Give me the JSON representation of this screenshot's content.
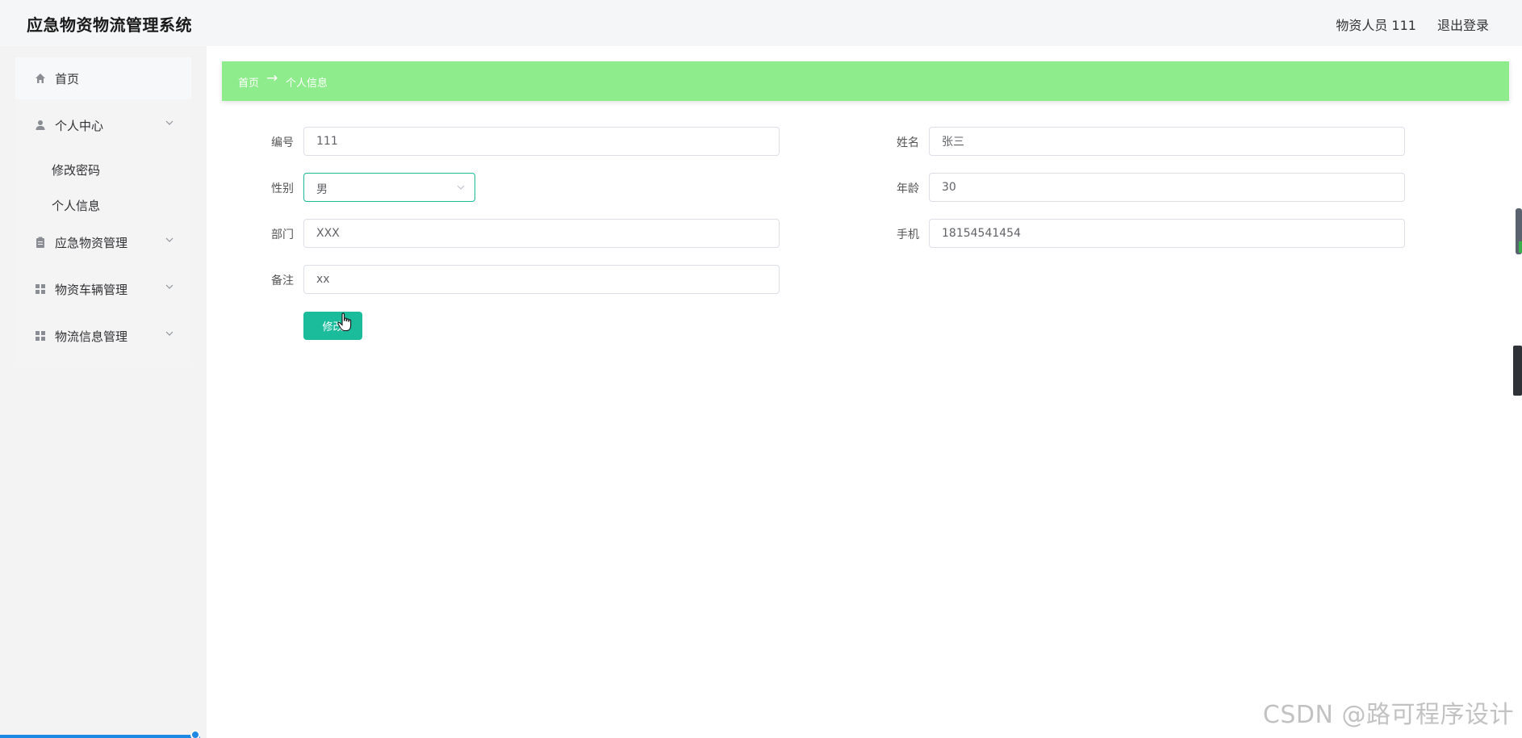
{
  "header": {
    "title": "应急物资物流管理系统",
    "user": "物资人员 111",
    "logout": "退出登录"
  },
  "sidebar": {
    "items": [
      {
        "label": "首页",
        "icon": "home-icon"
      },
      {
        "label": "个人中心",
        "icon": "user-icon",
        "children": [
          "修改密码",
          "个人信息"
        ]
      },
      {
        "label": "应急物资管理",
        "icon": "clipboard-icon"
      },
      {
        "label": "物资车辆管理",
        "icon": "grid-icon"
      },
      {
        "label": "物流信息管理",
        "icon": "grid-icon"
      }
    ]
  },
  "breadcrumb": {
    "home": "首页",
    "separator": "→",
    "current": "个人信息"
  },
  "form": {
    "fields": [
      {
        "label": "编号",
        "value": "111"
      },
      {
        "label": "姓名",
        "value": "张三"
      },
      {
        "label": "性别",
        "value": "男"
      },
      {
        "label": "年龄",
        "value": "30"
      },
      {
        "label": "部门",
        "value": "XXX"
      },
      {
        "label": "手机",
        "value": "18154541454"
      },
      {
        "label": "备注",
        "value": "xx"
      }
    ],
    "submit_label": "修改"
  },
  "colors": {
    "accent": "#1abc9c",
    "breadcrumb_bg": "#8fec8c",
    "progress": "#1e88e5"
  },
  "watermark": "CSDN @路可程序设计"
}
